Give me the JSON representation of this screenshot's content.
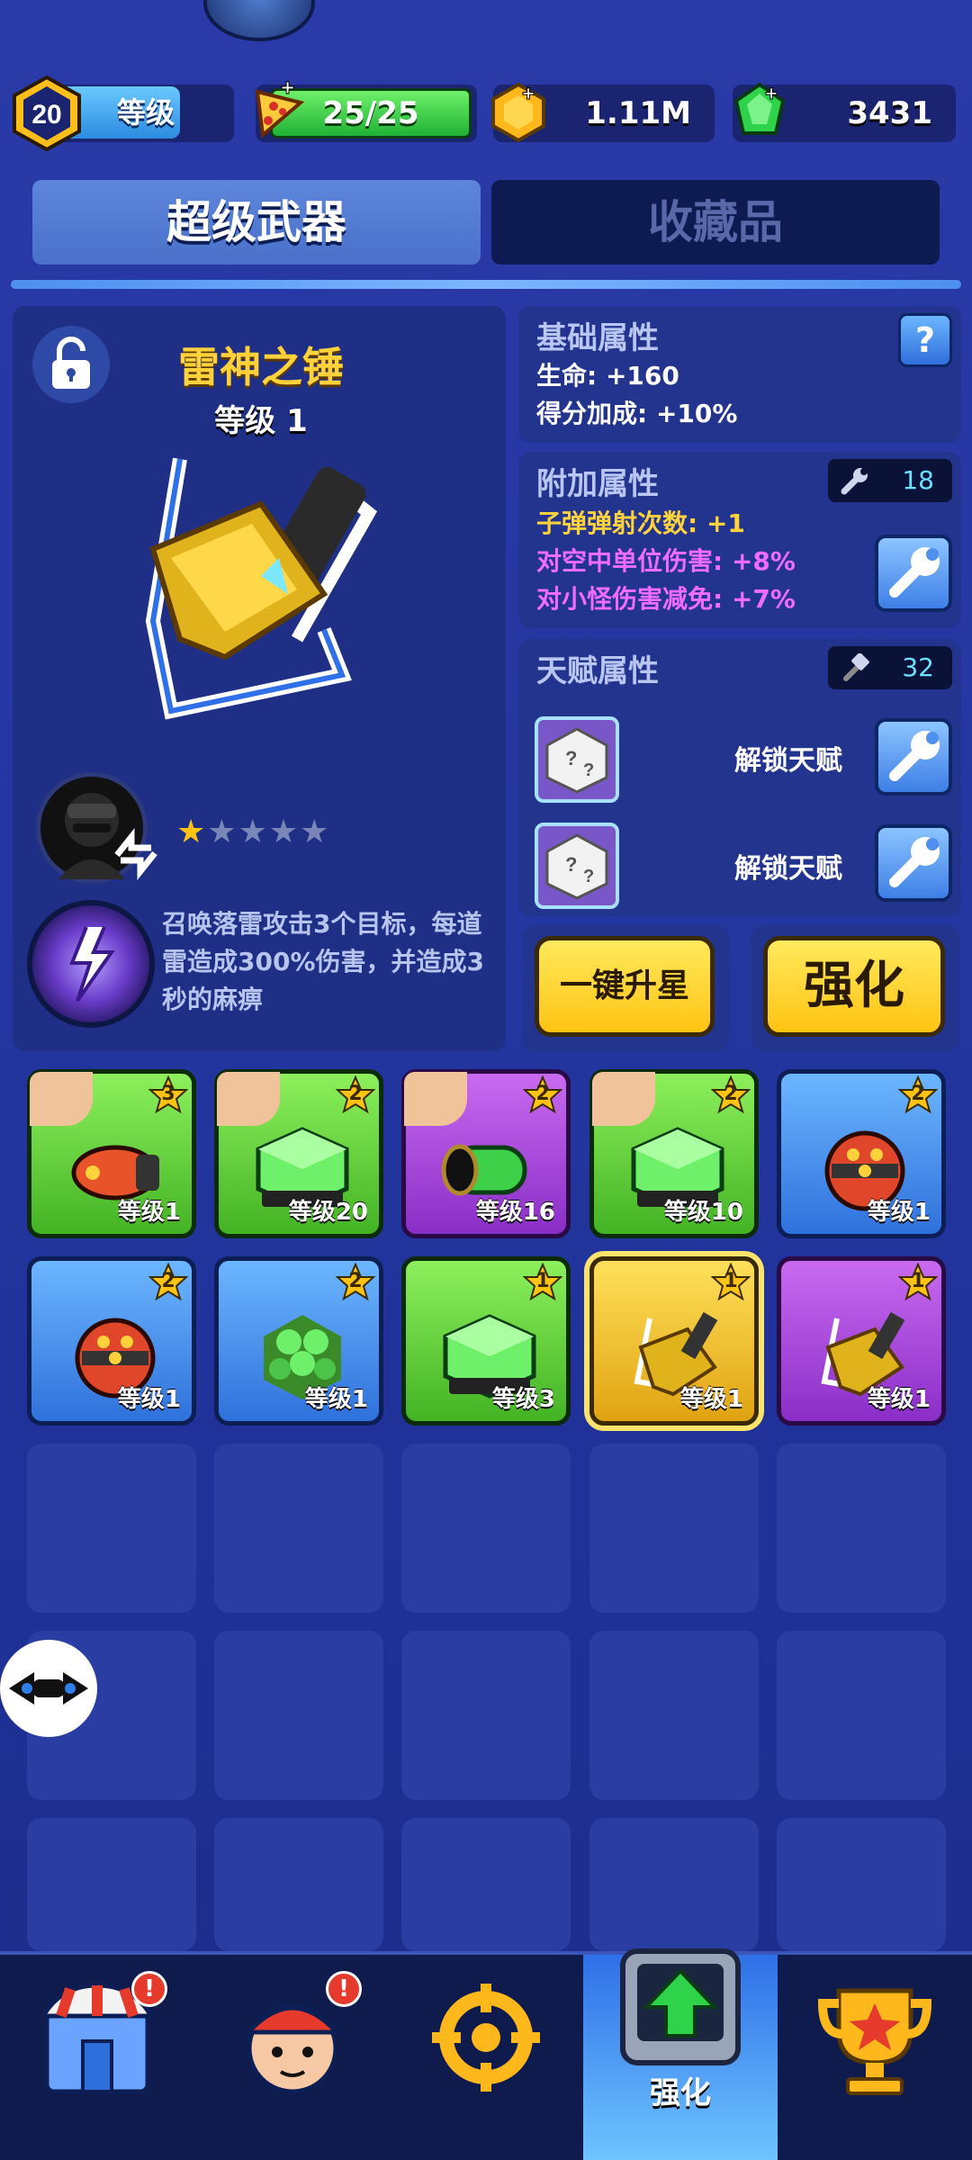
{
  "resources": {
    "level_number": "20",
    "level_label": "等级",
    "energy": "25/25",
    "coins": "1.11M",
    "gems": "3431"
  },
  "tabs": [
    {
      "label": "超级武器",
      "active": true
    },
    {
      "label": "收藏品",
      "active": false
    }
  ],
  "weapon": {
    "name": "雷神之锤",
    "level": "等级 1",
    "stars_filled": 1,
    "stars_total": 5,
    "skill_description": "召唤落雷攻击3个目标，每道雷造成300%伤害，并造成3秒的麻痹"
  },
  "base_attributes": {
    "title": "基础属性",
    "help": "?",
    "lines": [
      "生命: +160",
      "得分加成: +10%"
    ]
  },
  "extra_attributes": {
    "title": "附加属性",
    "count": "18",
    "lines": [
      {
        "text": "子弹弹射次数: +1",
        "color": "#ffd23c"
      },
      {
        "text": "对空中单位伤害: +8%",
        "color": "#f06bff"
      },
      {
        "text": "对小怪伤害减免: +7%",
        "color": "#f06bff"
      }
    ]
  },
  "talent_attributes": {
    "title": "天赋属性",
    "count": "32",
    "slots": [
      "解锁天赋",
      "解锁天赋"
    ]
  },
  "buttons": {
    "one_key_star": "一键升星",
    "enhance": "强化"
  },
  "inventory": [
    {
      "level": "等级1",
      "stars": "3",
      "rarity": "green",
      "item": "orange-rocket",
      "hero": true
    },
    {
      "level": "等级20",
      "stars": "2",
      "rarity": "green",
      "item": "green-cube",
      "hero": true
    },
    {
      "level": "等级16",
      "stars": "2",
      "rarity": "purple",
      "item": "green-cannon",
      "hero": true
    },
    {
      "level": "等级10",
      "stars": "2",
      "rarity": "green",
      "item": "green-cube",
      "hero": true
    },
    {
      "level": "等级1",
      "stars": "2",
      "rarity": "blue",
      "item": "red-bomb",
      "hero": false
    },
    {
      "level": "等级1",
      "stars": "2",
      "rarity": "blue",
      "item": "red-bomb",
      "hero": false
    },
    {
      "level": "等级1",
      "stars": "2",
      "rarity": "blue",
      "item": "green-hex-cluster",
      "hero": false
    },
    {
      "level": "等级3",
      "stars": "1",
      "rarity": "green",
      "item": "green-cube",
      "hero": false
    },
    {
      "level": "等级1",
      "stars": "1",
      "rarity": "gold",
      "item": "thor-hammer",
      "hero": false
    },
    {
      "level": "等级1",
      "stars": "1",
      "rarity": "purple",
      "item": "thor-hammer",
      "hero": false
    }
  ],
  "nav": [
    {
      "icon": "shop-icon",
      "label": "",
      "badge": "!",
      "active": false
    },
    {
      "icon": "hero-icon",
      "label": "",
      "badge": "!",
      "active": false
    },
    {
      "icon": "target-icon",
      "label": "",
      "badge": "",
      "active": false
    },
    {
      "icon": "upgrade-icon",
      "label": "强化",
      "badge": "",
      "active": true
    },
    {
      "icon": "trophy-icon",
      "label": "",
      "badge": "",
      "active": false
    }
  ]
}
